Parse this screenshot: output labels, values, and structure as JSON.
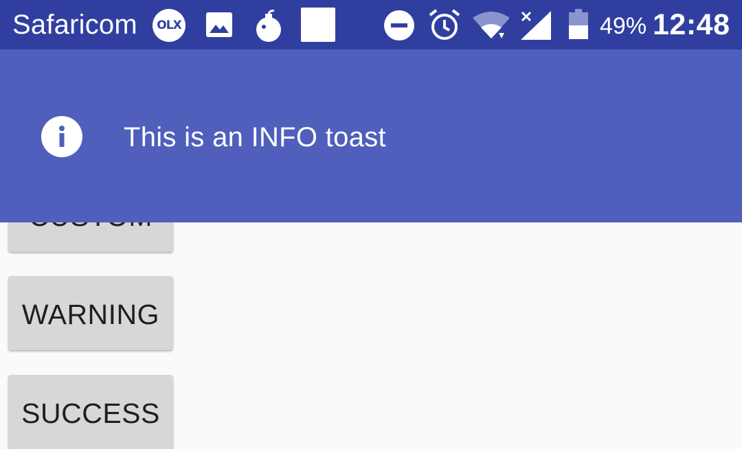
{
  "status_bar": {
    "carrier": "Safaricom",
    "olx_badge": "OLX",
    "battery_percent": "49%",
    "time": "12:48",
    "icons": [
      "olx-icon",
      "image-icon",
      "bomb-icon",
      "square-icon",
      "do-not-disturb-icon",
      "alarm-icon",
      "wifi-icon",
      "signal-no-service-icon",
      "battery-icon"
    ]
  },
  "buttons": {
    "custom": "CUSTOM",
    "warning": "WARNING",
    "success": "SUCCESS"
  },
  "toast": {
    "message": "This is an INFO toast",
    "icon": "info-icon"
  },
  "colors": {
    "status_bar": "#303f9f",
    "toast_bg": "#4f5fbb",
    "button_bg": "#d6d7d7",
    "page_bg": "#fafafa"
  }
}
